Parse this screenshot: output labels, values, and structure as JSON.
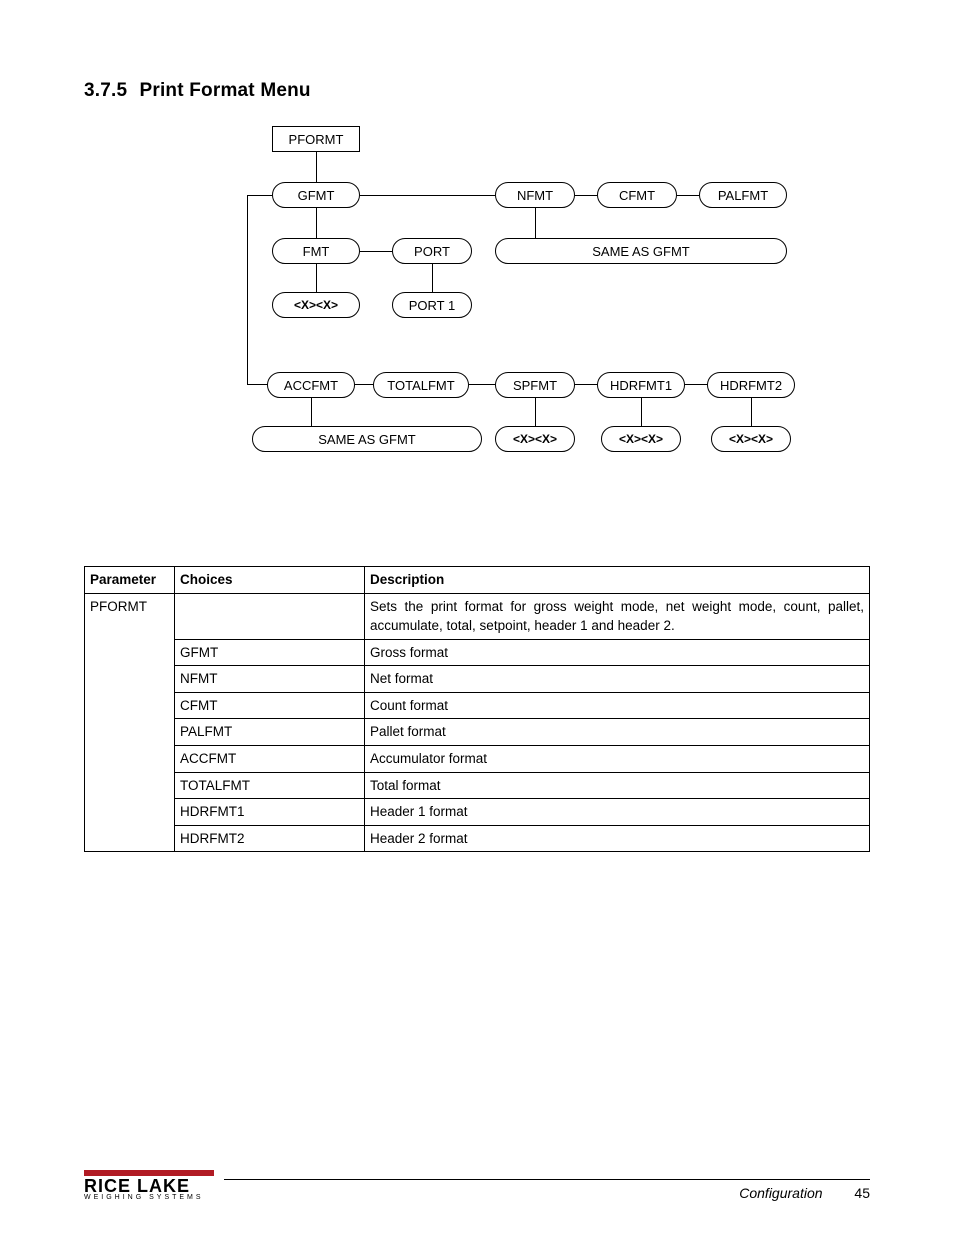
{
  "heading": {
    "number": "3.7.5",
    "title": "Print Format Menu"
  },
  "diagram": {
    "root": "PFORMT",
    "row1": [
      "GFMT",
      "NFMT",
      "CFMT",
      "PALFMT"
    ],
    "gfmt_children": {
      "fmt": "FMT",
      "port": "PORT"
    },
    "same_as_gfmt": "SAME AS GFMT",
    "fmt_leaf": "<X><X>",
    "port_leaf": "PORT 1",
    "row2": [
      "ACCFMT",
      "TOTALFMT",
      "SPFMT",
      "HDRFMT1",
      "HDRFMT2"
    ],
    "row2_same": "SAME AS GFMT",
    "row2_leaf": "<X><X>"
  },
  "table": {
    "headers": {
      "param": "Parameter",
      "choices": "Choices",
      "desc": "Description"
    },
    "rows": [
      {
        "param": "PFORMT",
        "choices": "",
        "desc": "Sets the print format for gross weight mode, net weight mode, count, pallet, accumulate, total, setpoint, header 1 and header 2."
      },
      {
        "param": "",
        "choices": "GFMT",
        "desc": "Gross format"
      },
      {
        "param": "",
        "choices": "NFMT",
        "desc": "Net format"
      },
      {
        "param": "",
        "choices": "CFMT",
        "desc": "Count format"
      },
      {
        "param": "",
        "choices": "PALFMT",
        "desc": "Pallet format"
      },
      {
        "param": "",
        "choices": "ACCFMT",
        "desc": "Accumulator format"
      },
      {
        "param": "",
        "choices": "TOTALFMT",
        "desc": "Total format"
      },
      {
        "param": "",
        "choices": "HDRFMT1",
        "desc": "Header 1 format"
      },
      {
        "param": "",
        "choices": "HDRFMT2",
        "desc": "Header 2 format"
      }
    ]
  },
  "footer": {
    "brand_top": "RICE LAKE",
    "brand_sub": "WEIGHING SYSTEMS",
    "section": "Configuration",
    "page": "45"
  }
}
